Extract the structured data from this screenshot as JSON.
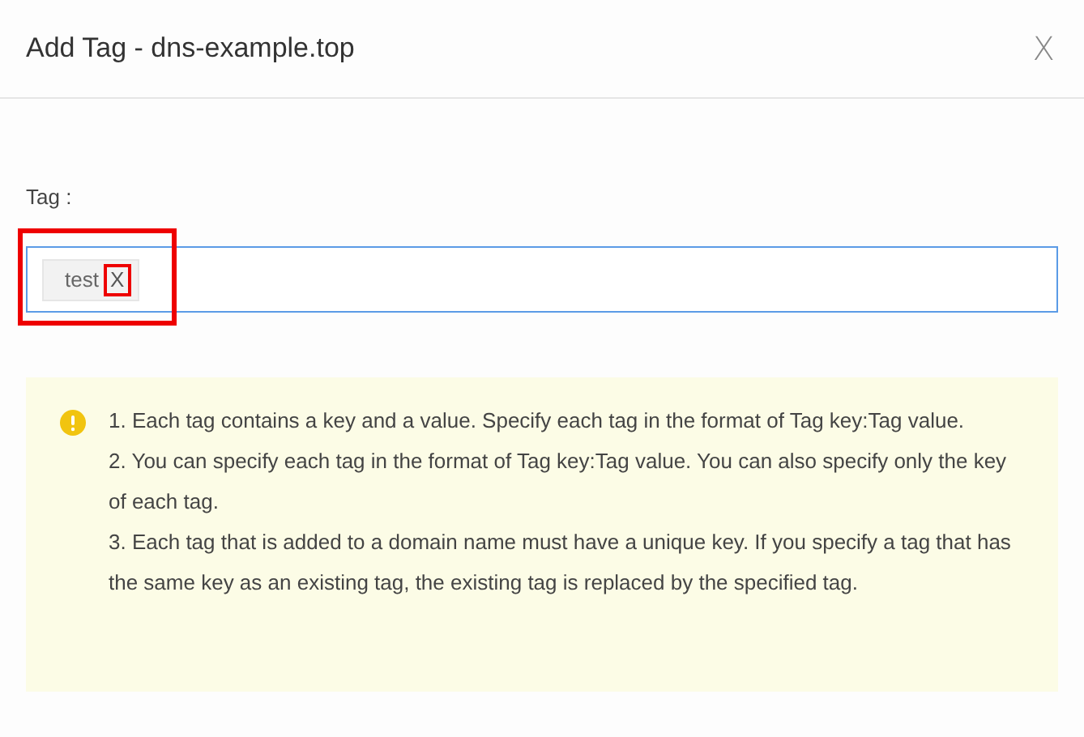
{
  "dialog": {
    "title": "Add Tag - dns-example.top",
    "close": "X"
  },
  "tag_field": {
    "label": "Tag :",
    "highlighted": true,
    "tags": [
      {
        "text": "test",
        "remove": "X",
        "remove_highlighted": true
      }
    ]
  },
  "notice": {
    "items": [
      "1. Each tag contains a key and a value. Specify each tag in the format of Tag key:Tag value.",
      "2. You can specify each tag in the format of Tag key:Tag value. You can also specify only the key of each tag.",
      "3. Each tag that is added to a domain name must have a unique key. If you specify a tag that has the same key as an existing tag, the existing tag is replaced by the specified tag."
    ]
  }
}
